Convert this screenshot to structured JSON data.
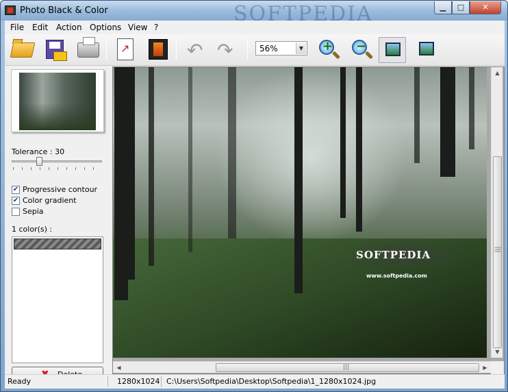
{
  "window": {
    "title": "Photo Black & Color",
    "watermark": "SOFTPEDIA",
    "min_glyph": "▁",
    "max_glyph": "□",
    "close_glyph": "✕"
  },
  "menu": [
    "File",
    "Edit",
    "Action",
    "Options",
    "View",
    "?"
  ],
  "toolbar": {
    "zoom_value": "56%",
    "dropdown_glyph": "▼",
    "undo_glyph": "↶",
    "redo_glyph": "↷",
    "icons": [
      "open-icon",
      "save-icon",
      "print-icon",
      "export-icon",
      "movie-icon",
      "undo-icon",
      "redo-icon",
      "zoom-in-icon",
      "zoom-out-icon",
      "fit-window-icon",
      "actual-size-icon"
    ]
  },
  "left_panel": {
    "tolerance_label": "Tolerance : 30",
    "tolerance_value": 30,
    "tolerance_fraction": 0.3,
    "options": [
      {
        "label": "Progressive contour",
        "checked": true
      },
      {
        "label": "Color gradient",
        "checked": true
      },
      {
        "label": "Sepia",
        "checked": false
      }
    ],
    "check_glyph": "✔",
    "colors_label": "1 color(s) :",
    "delete_label": "Delete",
    "delete_glyph": "✖"
  },
  "image": {
    "watermark_brand": "SOFTPEDIA",
    "watermark_url": "www.softpedia.com"
  },
  "scrollbars": {
    "up": "▲",
    "down": "▼",
    "left": "◀",
    "right": "▶",
    "grip": "|||"
  },
  "status": {
    "state": "Ready",
    "dimensions": "1280x1024",
    "path": "C:\\Users\\Softpedia\\Desktop\\Softpedia\\1_1280x1024.jpg"
  },
  "colors": {
    "titlebar": "#9dbcdc",
    "close_button": "#c4412b",
    "panel": "#f0f0f0"
  }
}
